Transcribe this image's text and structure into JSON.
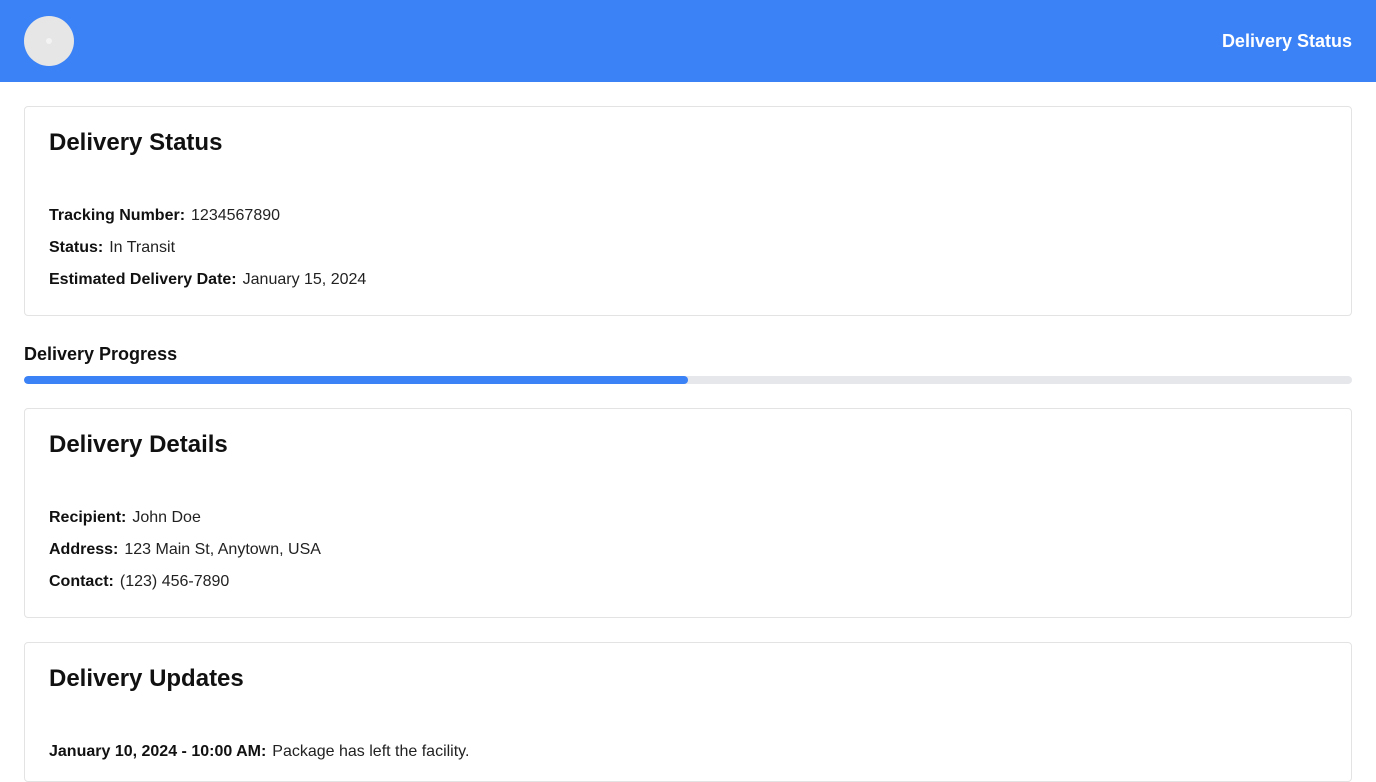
{
  "header": {
    "title": "Delivery Status"
  },
  "status_card": {
    "heading": "Delivery Status",
    "tracking_label": "Tracking Number:",
    "tracking_value": "1234567890",
    "status_label": "Status:",
    "status_value": "In Transit",
    "eta_label": "Estimated Delivery Date:",
    "eta_value": "January 15, 2024"
  },
  "progress": {
    "label": "Delivery Progress",
    "fraction": 0.5,
    "fill_color": "#3b82f6",
    "track_color": "#e5e7eb"
  },
  "details_card": {
    "heading": "Delivery Details",
    "recipient_label": "Recipient:",
    "recipient_value": "John Doe",
    "address_label": "Address:",
    "address_value": "123 Main St, Anytown, USA",
    "contact_label": "Contact:",
    "contact_value": "(123) 456-7890"
  },
  "updates_card": {
    "heading": "Delivery Updates",
    "items": [
      {
        "time": "January 10, 2024 - 10:00 AM:",
        "message": "Package has left the facility."
      }
    ]
  },
  "colors": {
    "accent": "#3b82f6",
    "header_text": "#ffffff"
  }
}
